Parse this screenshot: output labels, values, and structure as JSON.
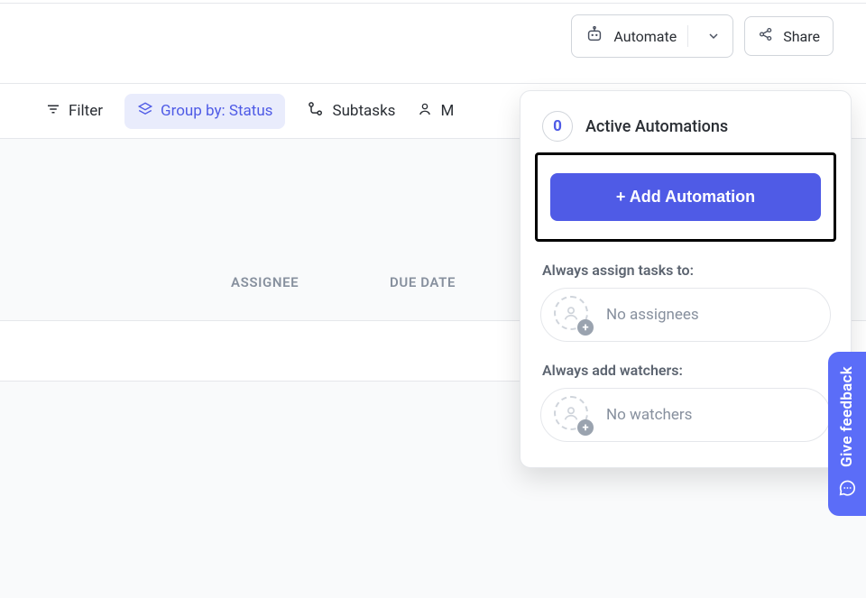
{
  "header": {
    "automate_label": "Automate",
    "share_label": "Share"
  },
  "toolbar": {
    "filter_label": "Filter",
    "groupby_label": "Group by: Status",
    "subtasks_label": "Subtasks",
    "me_label": "M"
  },
  "table": {
    "columns": {
      "assignee": "ASSIGNEE",
      "due_date": "DUE DATE"
    }
  },
  "automations_panel": {
    "count": "0",
    "title": "Active Automations",
    "add_button": "+ Add Automation",
    "assign_label": "Always assign tasks to:",
    "assign_value": "No assignees",
    "watchers_label": "Always add watchers:",
    "watchers_value": "No watchers"
  },
  "feedback": {
    "label": "Give feedback"
  }
}
